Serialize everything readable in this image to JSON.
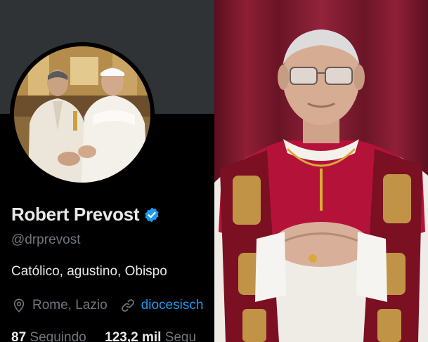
{
  "profile": {
    "display_name": "Robert Prevost",
    "handle": "@drprevost",
    "bio": "Católico, agustino, Obispo",
    "location": "Rome, Lazio",
    "website": "diocesisch",
    "following_count": "87",
    "following_label": "Seguindo",
    "followers_count": "123,2 mil",
    "followers_label": "Segu",
    "icons": {
      "verified": "verified-badge-icon",
      "location": "location-pin-icon",
      "link": "link-icon"
    }
  },
  "colors": {
    "background": "#000000",
    "banner": "#2f3336",
    "primary_text": "#e7e9ea",
    "secondary_text": "#71767b",
    "accent": "#1d9bf0"
  }
}
